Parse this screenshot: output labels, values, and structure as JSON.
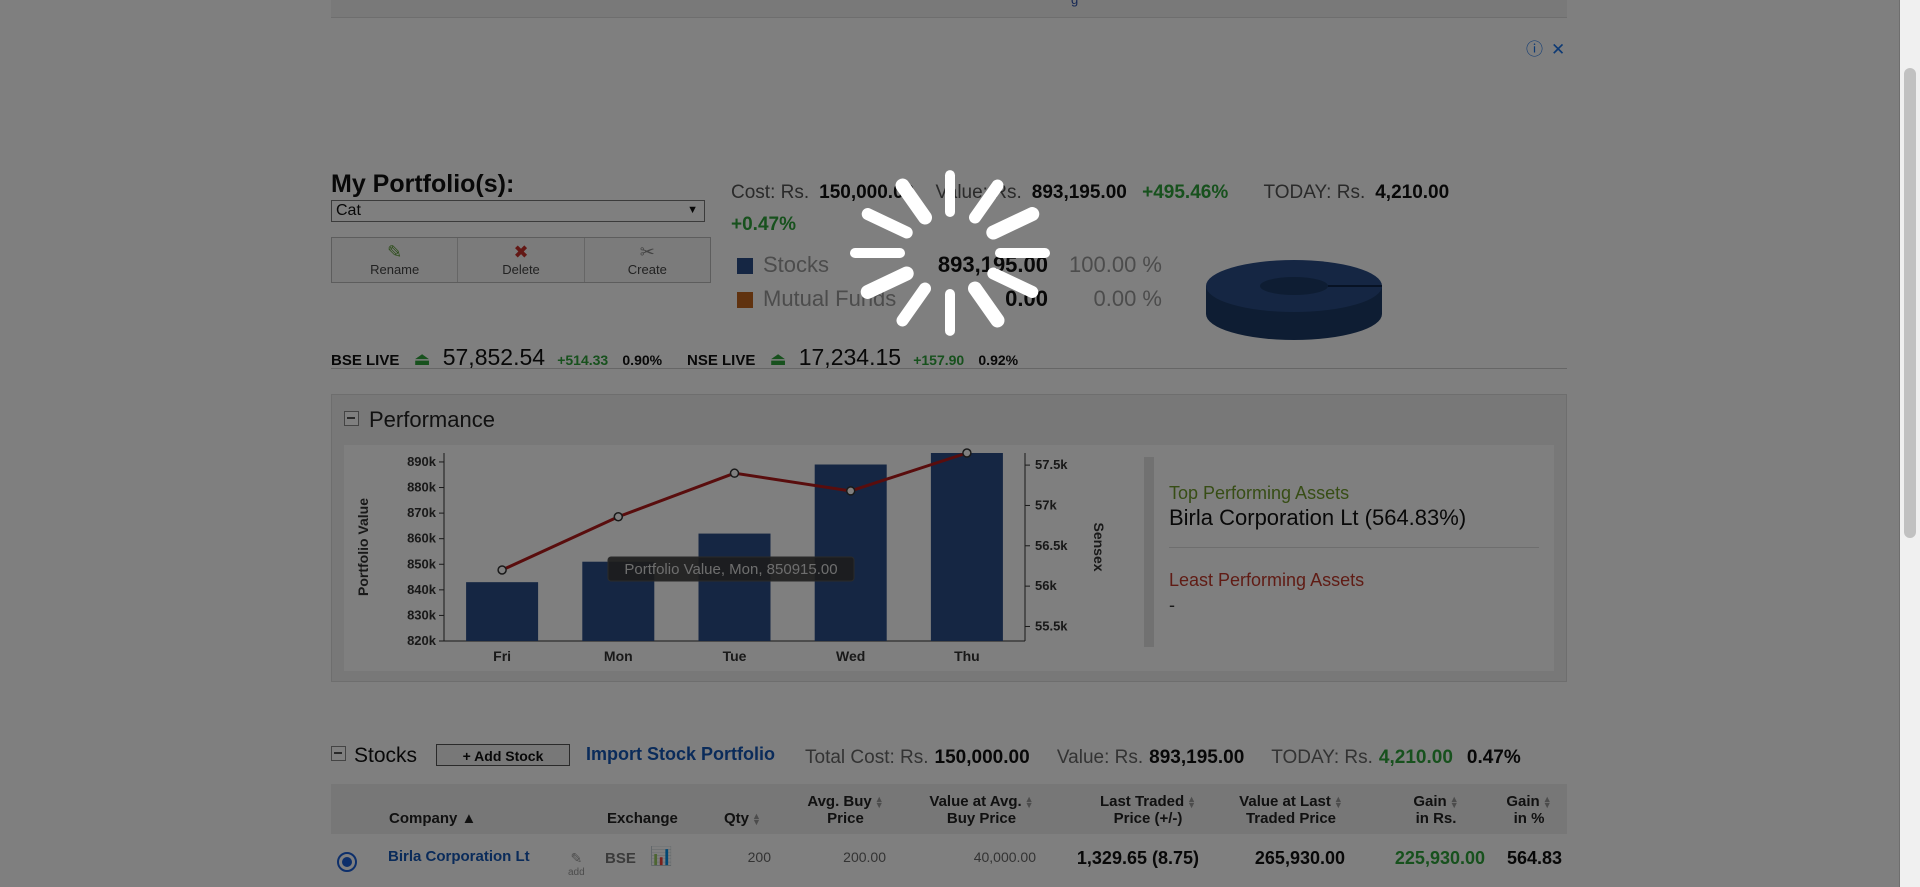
{
  "top_strip": {
    "text": "g"
  },
  "ad": {
    "info_icon": "info-icon",
    "close_icon": "close-icon"
  },
  "portfolio": {
    "title": "My Portfolio(s):",
    "selected": "Cat",
    "buttons": {
      "rename": "Rename",
      "delete": "Delete",
      "create": "Create"
    }
  },
  "summary": {
    "cost_label": "Cost: Rs.",
    "cost": "150,000.00",
    "value_label": "Value: Rs.",
    "value": "893,195.00",
    "value_change": "+495.46%",
    "today_label": "TODAY: Rs.",
    "today": "4,210.00",
    "today_change": "+0.47%"
  },
  "allocation": [
    {
      "label": "Stocks",
      "value": "893,195.00",
      "pct": "100.00 %",
      "color": "#2a4d86"
    },
    {
      "label": "Mutual Funds",
      "value": "0.00",
      "pct": "0.00 %",
      "color": "#c0641f"
    }
  ],
  "indices": {
    "bse": {
      "label": "BSE LIVE",
      "value": "57,852.54",
      "change": "+514.33",
      "pct": "0.90%"
    },
    "nse": {
      "label": "NSE LIVE",
      "value": "17,234.15",
      "change": "+157.90",
      "pct": "0.92%"
    }
  },
  "performance": {
    "title": "Performance",
    "top_title": "Top Performing Assets",
    "top_name": "Birla Corporation Lt (564.83%)",
    "least_title": "Least Performing Assets",
    "least_name": "-"
  },
  "chart_data": {
    "type": "bar",
    "categories": [
      "Fri",
      "Mon",
      "Tue",
      "Wed",
      "Thu"
    ],
    "series": [
      {
        "name": "Portfolio Value",
        "type": "bar",
        "values": [
          843000,
          851000,
          862000,
          889000,
          893500
        ]
      },
      {
        "name": "Sensex",
        "type": "line",
        "values": [
          56200,
          56860,
          57400,
          57180,
          57650
        ]
      }
    ],
    "ylabel": "Portfolio Value",
    "y2label": "Sensex",
    "ylim": [
      820000,
      893500
    ],
    "y2lim": [
      55320,
      57650
    ],
    "yticks": [
      "820k",
      "830k",
      "840k",
      "850k",
      "860k",
      "870k",
      "880k",
      "890k"
    ],
    "y2ticks": [
      "55.5k",
      "56k",
      "56.5k",
      "57k",
      "57.5k"
    ],
    "tooltip": "Portfolio Value, Mon, 850915.00",
    "bar_color": "#2a4d86",
    "line_color": "#b31b1b"
  },
  "stocks": {
    "title": "Stocks",
    "add_label": "+ Add Stock",
    "import_label": "Import Stock Portfolio",
    "total_cost_label": "Total Cost: Rs.",
    "total_cost": "150,000.00",
    "value_label": "Value: Rs.",
    "value": "893,195.00",
    "today_label": "TODAY: Rs.",
    "today": "4,210.00",
    "today_pct": "0.47%",
    "columns": {
      "company": "Company",
      "exchange": "Exchange",
      "qty": "Qty",
      "avg_buy_1": "Avg. Buy",
      "avg_buy_2": "Price",
      "val_avg_1": "Value at Avg.",
      "val_avg_2": "Buy Price",
      "ltp_1": "Last Traded",
      "ltp_2": "Price (+/-)",
      "val_ltp_1": "Value at Last",
      "val_ltp_2": "Traded Price",
      "gain_1": "Gain",
      "gain_2": "in Rs.",
      "gainp_1": "Gain",
      "gainp_2": "in %"
    },
    "rows": [
      {
        "company": "Birla Corporation Lt",
        "edit": "add",
        "exchange": "BSE",
        "qty": "200",
        "avg_buy": "200.00",
        "val_avg": "40,000.00",
        "ltp": "1,329.65 (8.75)",
        "val_ltp": "265,930.00",
        "gain": "225,930.00",
        "gain_pct": "564.83"
      }
    ]
  }
}
